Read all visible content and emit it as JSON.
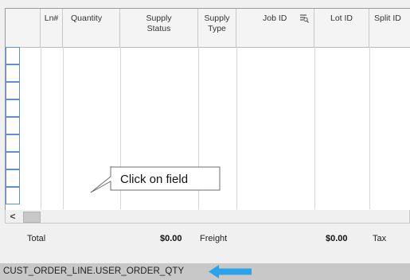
{
  "grid": {
    "columns": [
      {
        "label": ""
      },
      {
        "label": "Ln#"
      },
      {
        "label": "Quantity"
      },
      {
        "label": "Supply Status"
      },
      {
        "label": "Supply Type"
      },
      {
        "label": "Job ID"
      },
      {
        "label": "Lot ID"
      },
      {
        "label": "Split ID"
      }
    ],
    "rows": 9,
    "scroll_left_label": "<",
    "filter_icon": "column-filter-icon"
  },
  "totals": {
    "total_label": "Total",
    "total_amount": "$0.00",
    "freight_label": "Freight",
    "freight_amount": "$0.00",
    "tax_label": "Tax"
  },
  "callout": {
    "text": "Click on field"
  },
  "status_bar": {
    "field_path": "CUST_ORDER_LINE.USER_ORDER_QTY",
    "arrow_color": "#2aa3e8"
  }
}
